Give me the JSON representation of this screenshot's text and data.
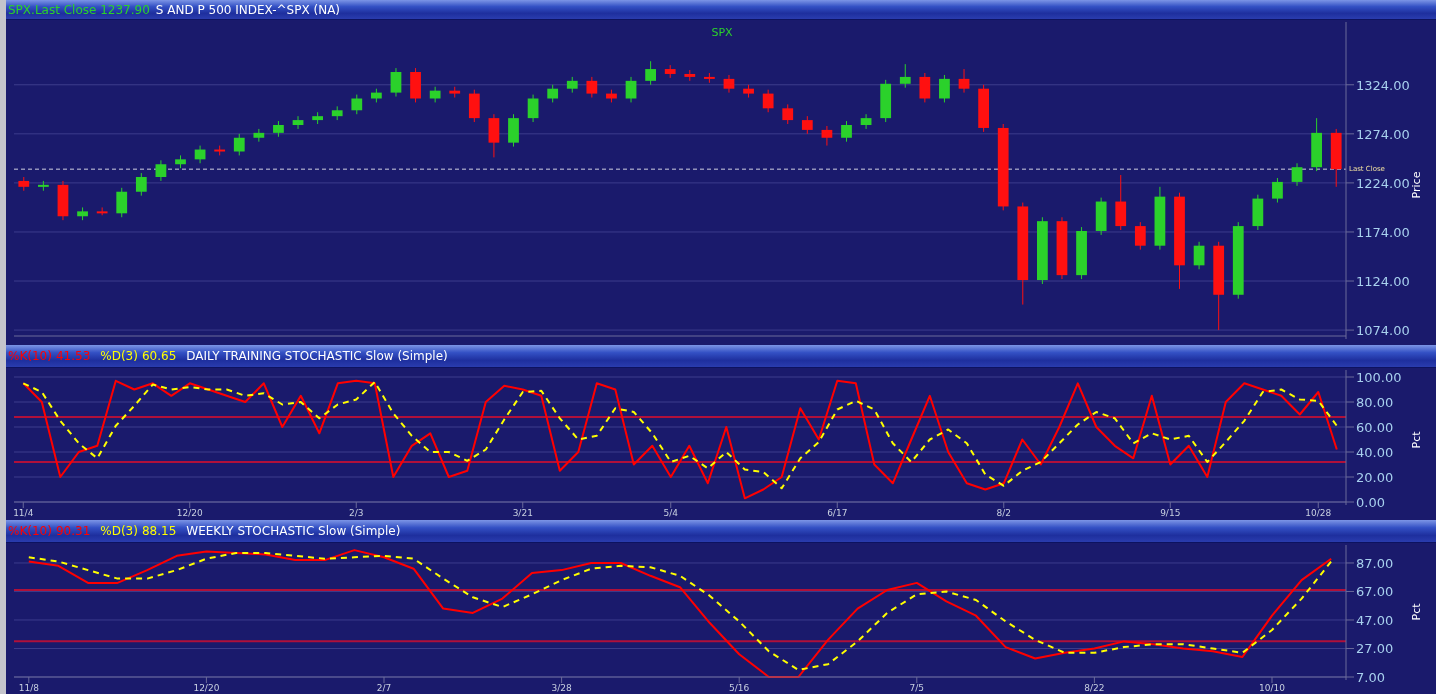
{
  "price_panel": {
    "kind": "price",
    "header": {
      "symbol_label": "SPX.Last Close 1237.90",
      "description": "S AND P 500 INDEX-^SPX (NA)"
    },
    "chart_data": {
      "type": "candlestick",
      "title": "SPX",
      "ylabel": "Price",
      "ylim": [
        1069,
        1390
      ],
      "grid": true,
      "yticks": [
        {
          "value": 1074,
          "label": "1074.00"
        },
        {
          "value": 1124,
          "label": "1124.00"
        },
        {
          "value": 1174,
          "label": "1174.00"
        },
        {
          "value": 1224,
          "label": "1224.00"
        },
        {
          "value": 1274,
          "label": "1274.00"
        },
        {
          "value": 1324,
          "label": "1324.00"
        }
      ],
      "categories": [
        null,
        null,
        null,
        null,
        null,
        null,
        null,
        null,
        null,
        null,
        null,
        null,
        null,
        null,
        null,
        null,
        null,
        null,
        null,
        null,
        null,
        null,
        null,
        null,
        null,
        null,
        null,
        null,
        null,
        null,
        null,
        null,
        null,
        null,
        null,
        null,
        null,
        null,
        null,
        null,
        null,
        null,
        null,
        null,
        null,
        null,
        null,
        null,
        null,
        null,
        null,
        null,
        null,
        null,
        null,
        null,
        null,
        null,
        null,
        null,
        null,
        null,
        null,
        null,
        null,
        null,
        null,
        null
      ],
      "ohlc": [
        [
          1226,
          1230,
          1216,
          1220
        ],
        [
          1220,
          1226,
          1216,
          1222
        ],
        [
          1222,
          1226,
          1186,
          1190
        ],
        [
          1190,
          1199,
          1186,
          1195
        ],
        [
          1195,
          1199,
          1191,
          1193
        ],
        [
          1193,
          1219,
          1189,
          1215
        ],
        [
          1215,
          1234,
          1211,
          1230
        ],
        [
          1230,
          1247,
          1226,
          1243
        ],
        [
          1243,
          1252,
          1239,
          1248
        ],
        [
          1248,
          1262,
          1244,
          1258
        ],
        [
          1258,
          1262,
          1252,
          1256
        ],
        [
          1256,
          1274,
          1252,
          1270
        ],
        [
          1270,
          1279,
          1266,
          1275
        ],
        [
          1275,
          1287,
          1271,
          1283
        ],
        [
          1283,
          1292,
          1279,
          1288
        ],
        [
          1288,
          1296,
          1284,
          1292
        ],
        [
          1292,
          1302,
          1288,
          1298
        ],
        [
          1298,
          1314,
          1294,
          1310
        ],
        [
          1310,
          1320,
          1306,
          1316
        ],
        [
          1316,
          1341,
          1312,
          1337
        ],
        [
          1337,
          1341,
          1306,
          1310
        ],
        [
          1310,
          1322,
          1306,
          1318
        ],
        [
          1318,
          1322,
          1311,
          1315
        ],
        [
          1315,
          1319,
          1286,
          1290
        ],
        [
          1290,
          1294,
          1250,
          1265
        ],
        [
          1265,
          1294,
          1261,
          1290
        ],
        [
          1290,
          1314,
          1286,
          1310
        ],
        [
          1310,
          1324,
          1306,
          1320
        ],
        [
          1320,
          1332,
          1316,
          1328
        ],
        [
          1328,
          1332,
          1311,
          1315
        ],
        [
          1315,
          1319,
          1306,
          1310
        ],
        [
          1310,
          1332,
          1306,
          1328
        ],
        [
          1328,
          1348,
          1324,
          1340
        ],
        [
          1340,
          1344,
          1331,
          1335
        ],
        [
          1335,
          1339,
          1328,
          1332
        ],
        [
          1332,
          1336,
          1326,
          1330
        ],
        [
          1330,
          1334,
          1316,
          1320
        ],
        [
          1320,
          1324,
          1311,
          1315
        ],
        [
          1315,
          1319,
          1296,
          1300
        ],
        [
          1300,
          1304,
          1284,
          1288
        ],
        [
          1288,
          1292,
          1274,
          1278
        ],
        [
          1278,
          1282,
          1262,
          1270
        ],
        [
          1270,
          1287,
          1266,
          1283
        ],
        [
          1283,
          1294,
          1279,
          1290
        ],
        [
          1290,
          1329,
          1286,
          1325
        ],
        [
          1325,
          1345,
          1321,
          1332
        ],
        [
          1332,
          1336,
          1306,
          1310
        ],
        [
          1310,
          1334,
          1306,
          1330
        ],
        [
          1330,
          1340,
          1316,
          1320
        ],
        [
          1320,
          1324,
          1276,
          1280
        ],
        [
          1280,
          1284,
          1196,
          1200
        ],
        [
          1200,
          1204,
          1100,
          1125
        ],
        [
          1125,
          1189,
          1121,
          1185
        ],
        [
          1185,
          1189,
          1126,
          1130
        ],
        [
          1130,
          1179,
          1126,
          1175
        ],
        [
          1175,
          1209,
          1171,
          1205
        ],
        [
          1205,
          1232,
          1176,
          1180
        ],
        [
          1180,
          1184,
          1156,
          1160
        ],
        [
          1160,
          1220,
          1156,
          1210
        ],
        [
          1210,
          1214,
          1116,
          1140
        ],
        [
          1140,
          1164,
          1136,
          1160
        ],
        [
          1160,
          1164,
          1074,
          1110
        ],
        [
          1110,
          1184,
          1106,
          1180
        ],
        [
          1180,
          1212,
          1176,
          1208
        ],
        [
          1208,
          1229,
          1204,
          1225
        ],
        [
          1225,
          1244,
          1221,
          1240
        ],
        [
          1240,
          1290,
          1236,
          1275
        ],
        [
          1275,
          1279,
          1220,
          1238
        ]
      ],
      "ref_lines": [
        {
          "axis": "y",
          "value": 1238,
          "label": "Last Close"
        }
      ]
    }
  },
  "daily_panel": {
    "kind": "stochastic",
    "header": {
      "k_value": "41.53",
      "d_value": "60.65",
      "title": "DAILY TRAINING STOCHASTIC Slow (Simple)"
    },
    "chart_data": {
      "type": "line",
      "ylabel": "Pct",
      "ylim": [
        0,
        100
      ],
      "grid": true,
      "yticks": [
        {
          "value": 0,
          "label": "0.00"
        },
        {
          "value": 20,
          "label": "20.00"
        },
        {
          "value": 40,
          "label": "40.00"
        },
        {
          "value": 60,
          "label": "60.00"
        },
        {
          "value": 80,
          "label": "80.00"
        },
        {
          "value": 100,
          "label": "100.00"
        }
      ],
      "categories": [
        "11/4",
        null,
        null,
        null,
        null,
        null,
        null,
        null,
        null,
        "12/20",
        null,
        null,
        null,
        null,
        null,
        null,
        null,
        null,
        "2/3",
        null,
        null,
        null,
        null,
        null,
        null,
        null,
        null,
        "3/21",
        null,
        null,
        null,
        null,
        null,
        null,
        null,
        "5/4",
        null,
        null,
        null,
        null,
        null,
        null,
        null,
        null,
        "6/17",
        null,
        null,
        null,
        null,
        null,
        null,
        null,
        null,
        "8/2",
        null,
        null,
        null,
        null,
        null,
        null,
        null,
        null,
        "9/15",
        null,
        null,
        null,
        null,
        null,
        null,
        null,
        "10/28",
        null
      ],
      "series": [
        {
          "name": "%K(10)",
          "color": "#ff0000",
          "line_style": "solid",
          "values": [
            95,
            80,
            20,
            40,
            45,
            97,
            90,
            95,
            85,
            95,
            90,
            85,
            80,
            95,
            60,
            85,
            55,
            95,
            97,
            95,
            20,
            45,
            55,
            20,
            25,
            80,
            93,
            90,
            85,
            25,
            40,
            95,
            90,
            30,
            45,
            20,
            45,
            15,
            60,
            3,
            10,
            20,
            75,
            50,
            97,
            95,
            30,
            15,
            50,
            85,
            40,
            15,
            10,
            15,
            50,
            30,
            60,
            95,
            60,
            45,
            35,
            85,
            30,
            45,
            20,
            80,
            95,
            90,
            85,
            70,
            88,
            42
          ]
        },
        {
          "name": "%D(3)",
          "color": "#ffff00",
          "line_style": "dashed",
          "values": [
            95,
            88,
            65,
            47,
            35,
            61,
            77,
            94,
            90,
            92,
            90,
            90,
            85,
            87,
            78,
            80,
            67,
            78,
            82,
            96,
            71,
            53,
            40,
            40,
            33,
            42,
            66,
            88,
            89,
            67,
            50,
            53,
            75,
            72,
            55,
            32,
            37,
            27,
            40,
            26,
            24,
            11,
            35,
            48,
            74,
            81,
            74,
            47,
            32,
            50,
            58,
            47,
            22,
            13,
            25,
            32,
            47,
            62,
            72,
            67,
            47,
            55,
            50,
            53,
            32,
            48,
            65,
            88,
            90,
            82,
            81,
            61
          ]
        }
      ],
      "ref_lines": [
        {
          "axis": "y",
          "value": 68
        },
        {
          "axis": "y",
          "value": 32
        }
      ]
    }
  },
  "weekly_panel": {
    "kind": "stochastic",
    "header": {
      "k_value": "90.31",
      "d_value": "88.15",
      "title": "WEEKLY STOCHASTIC Slow (Simple)"
    },
    "chart_data": {
      "type": "line",
      "ylabel": "Pct",
      "ylim": [
        7,
        101
      ],
      "grid": true,
      "yticks": [
        {
          "value": 7,
          "label": "7.00"
        },
        {
          "value": 27,
          "label": "27.00"
        },
        {
          "value": 47,
          "label": "47.00"
        },
        {
          "value": 67,
          "label": "67.00"
        },
        {
          "value": 87,
          "label": "87.00"
        }
      ],
      "categories": [
        "11/8",
        null,
        null,
        null,
        null,
        null,
        "12/20",
        null,
        null,
        null,
        null,
        null,
        "2/7",
        null,
        null,
        null,
        null,
        null,
        "3/28",
        null,
        null,
        null,
        null,
        null,
        "5/16",
        null,
        null,
        null,
        null,
        null,
        "7/5",
        null,
        null,
        null,
        null,
        null,
        "8/22",
        null,
        null,
        null,
        null,
        null,
        "10/10",
        null,
        null
      ],
      "series": [
        {
          "name": "%K(10)",
          "color": "#ff0000",
          "line_style": "solid",
          "values": [
            88,
            85,
            73,
            73,
            82,
            92,
            95,
            94,
            93,
            89,
            89,
            96,
            91,
            83,
            55,
            52,
            62,
            80,
            82,
            87,
            87,
            78,
            70,
            45,
            23,
            7,
            7,
            33,
            55,
            68,
            73,
            60,
            50,
            28,
            20,
            24,
            27,
            32,
            30,
            27,
            25,
            21,
            50,
            75,
            90
          ]
        },
        {
          "name": "%D(3)",
          "color": "#ffff00",
          "line_style": "dashed",
          "values": [
            91,
            88,
            82,
            76,
            76,
            82,
            90,
            94,
            94,
            92,
            90,
            91,
            92,
            90,
            76,
            63,
            56,
            65,
            75,
            83,
            85,
            84,
            78,
            64,
            46,
            25,
            12,
            16,
            32,
            52,
            65,
            67,
            61,
            46,
            33,
            24,
            24,
            28,
            30,
            30,
            27,
            24,
            40,
            62,
            88
          ]
        }
      ],
      "ref_lines": [
        {
          "axis": "y",
          "value": 68
        },
        {
          "axis": "y",
          "value": 32
        }
      ]
    }
  }
}
